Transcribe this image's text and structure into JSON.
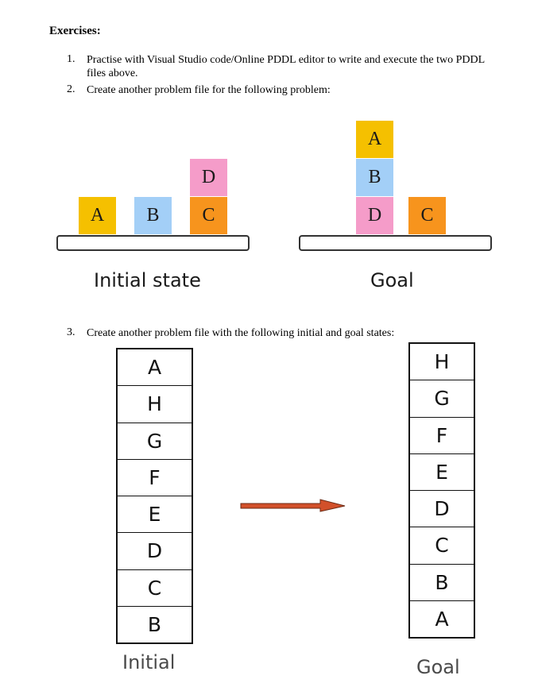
{
  "heading": "Exercises:",
  "items": [
    {
      "num": "1.",
      "text": "Practise with Visual Studio code/Online PDDL editor to write and execute the two PDDL files above."
    },
    {
      "num": "2.",
      "text": "Create another problem file for the following problem:"
    },
    {
      "num": "3.",
      "text": "Create another problem file with the following initial and goal states:"
    }
  ],
  "figure1": {
    "initial_caption": "Initial state",
    "goal_caption": "Goal",
    "initial_blocks": [
      {
        "label": "A",
        "color": "#F5C000"
      },
      {
        "label": "B",
        "color": "#A3CFF7"
      },
      {
        "label": "C",
        "color": "#F7941D"
      },
      {
        "label": "D",
        "color": "#F59CC9"
      }
    ],
    "goal_blocks": [
      {
        "label": "A",
        "color": "#F5C000"
      },
      {
        "label": "B",
        "color": "#A3CFF7"
      },
      {
        "label": "D",
        "color": "#F59CC9"
      },
      {
        "label": "C",
        "color": "#F7941D"
      }
    ]
  },
  "figure2": {
    "initial_caption": "Initial",
    "goal_caption": "Goal",
    "initial_stack": [
      "A",
      "H",
      "G",
      "F",
      "E",
      "D",
      "C",
      "B"
    ],
    "goal_stack": [
      "H",
      "G",
      "F",
      "E",
      "D",
      "C",
      "B",
      "A"
    ],
    "arrow_color": "#D2502A"
  }
}
